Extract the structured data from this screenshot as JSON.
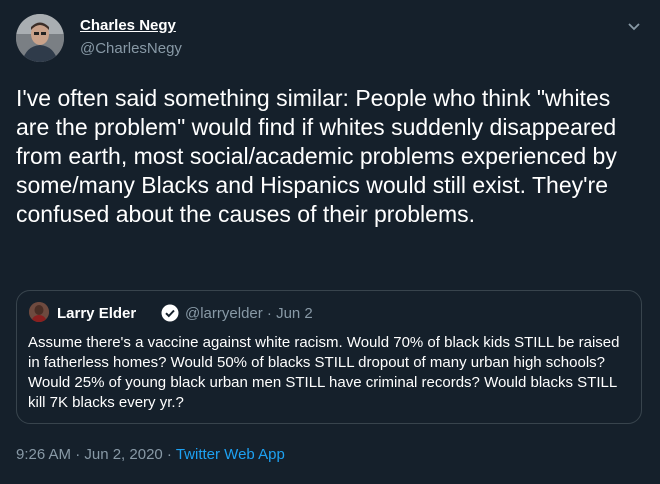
{
  "author": {
    "name": "Charles Negy",
    "handle": "@CharlesNegy"
  },
  "tweet": {
    "text": "I've often said something similar: People who think \"whites are the problem\" would find if whites suddenly disappeared from earth, most social/academic problems experienced by some/many Blacks and Hispanics would still exist. They're confused about the causes of their problems."
  },
  "quoted": {
    "name": "Larry Elder",
    "handle": "@larryelder",
    "date": "· Jun 2",
    "text": "Assume there's a vaccine against white racism. Would 70% of black kids STILL be raised in fatherless homes? Would 50% of blacks STILL dropout of many urban high schools? Would 25% of young black urban men STILL have criminal records? Would blacks STILL kill 7K blacks every yr.?"
  },
  "meta": {
    "time": "9:26 AM · Jun 2, 2020 ·",
    "app": "Twitter Web App"
  },
  "icons": {
    "caret": "chevron-down-icon",
    "verified": "verified-badge-icon"
  },
  "colors": {
    "background": "#15202b",
    "secondary_text": "#8899a6",
    "link": "#1da1f2",
    "border": "#38444d"
  }
}
